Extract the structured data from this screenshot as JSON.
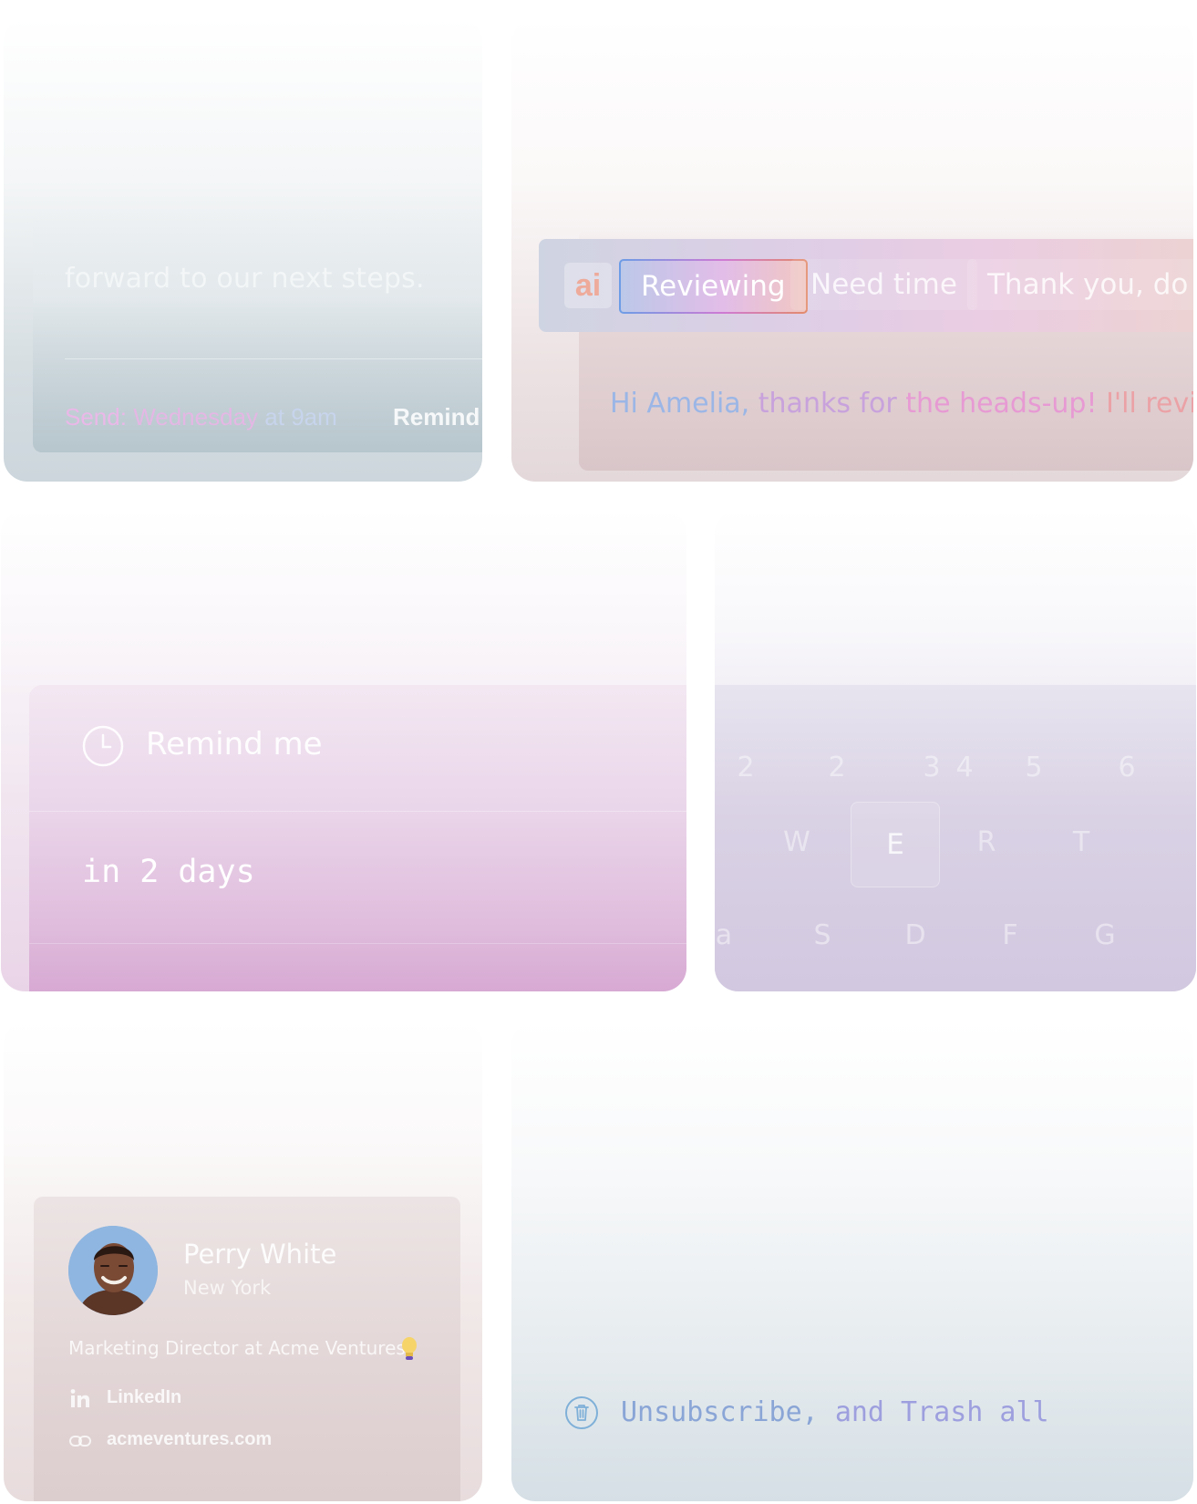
{
  "schedule_card": {
    "body_text": "forward to our next steps.",
    "send_label": "Send:",
    "send_day": "Wednesday",
    "send_at": "at",
    "send_time": "9am",
    "remind_label": "Remind"
  },
  "ai_card": {
    "badge": "ai",
    "chips": [
      "Reviewing",
      "Need time",
      "Thank you, do"
    ],
    "active_chip": "Reviewing",
    "reply_greeting": "Hi Amelia,",
    "reply_thanks": "thanks for",
    "reply_heads_up": "the heads-up!",
    "reply_review": "I'll review"
  },
  "remind_card": {
    "title": "Remind me",
    "value": "in 2 days",
    "icon": "clock-icon"
  },
  "keyboard_card": {
    "row_numbers": [
      "2",
      "2",
      "3",
      "4",
      "5",
      "6"
    ],
    "row_top": [
      "W",
      "E",
      "R",
      "T"
    ],
    "row_home": [
      "a",
      "S",
      "D",
      "F",
      "G"
    ],
    "highlighted_key": "E"
  },
  "contact_card": {
    "name": "Perry White",
    "city": "New York",
    "role": "Marketing Director at Acme Ventures",
    "links": [
      {
        "icon": "linkedin-icon",
        "label": "LinkedIn"
      },
      {
        "icon": "link-icon",
        "label": "acmeventures.com"
      }
    ]
  },
  "unsubscribe_card": {
    "text_part1": "Unsubscribe,",
    "text_part2": "and Trash all",
    "icon": "trash-icon"
  },
  "colors": {
    "accent_blue": "#6c9de6",
    "accent_pink": "#cf7ad4",
    "accent_orange": "#e38b6a",
    "remind_purple": "#d7a9d3"
  }
}
